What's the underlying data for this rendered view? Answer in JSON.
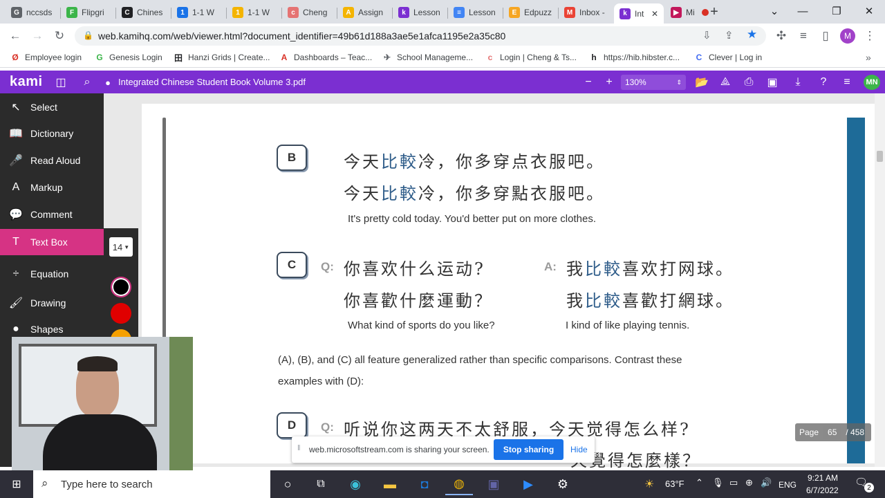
{
  "browser": {
    "tabs": [
      {
        "label": "nccsds",
        "fav": "G",
        "color": "#5f6368"
      },
      {
        "label": "Flipgri",
        "fav": "F",
        "color": "#3cb54a"
      },
      {
        "label": "Chines",
        "fav": "C",
        "color": "#202124"
      },
      {
        "label": "1-1 W",
        "fav": "1",
        "color": "#1a73e8"
      },
      {
        "label": "1-1 W",
        "fav": "1",
        "color": "#f4b400"
      },
      {
        "label": "Cheng",
        "fav": "c",
        "color": "#e57373"
      },
      {
        "label": "Assign",
        "fav": "A",
        "color": "#f4b400"
      },
      {
        "label": "Lesson",
        "fav": "k",
        "color": "#7b2fd1"
      },
      {
        "label": "Lesson",
        "fav": "≡",
        "color": "#4285f4"
      },
      {
        "label": "Edpuzz",
        "fav": "E",
        "color": "#f6a623"
      },
      {
        "label": "Inbox -",
        "fav": "M",
        "color": "#ea4335"
      },
      {
        "label": "Int",
        "fav": "k",
        "color": "#7b2fd1"
      },
      {
        "label": "Mi",
        "fav": "▶",
        "color": "#c2185b"
      }
    ],
    "new_tab": "+",
    "url": "web.kamihq.com/web/viewer.html?document_identifier=49b61d188a3ae5e1afca1195e2a35c80",
    "profile_initial": "M",
    "bookmarks": [
      {
        "label": "Employee login",
        "icon": "Ø",
        "color": "#d93025"
      },
      {
        "label": "Genesis Login",
        "icon": "G",
        "color": "#3cb54a"
      },
      {
        "label": "Hanzi Grids | Create...",
        "icon": "田",
        "color": "#202124"
      },
      {
        "label": "Dashboards – Teac...",
        "icon": "A",
        "color": "#d93025"
      },
      {
        "label": "School Manageme...",
        "icon": "✈",
        "color": "#5f6368"
      },
      {
        "label": "Login | Cheng & Ts...",
        "icon": "c",
        "color": "#e57373"
      },
      {
        "label": "https://hib.hibster.c...",
        "icon": "h",
        "color": "#202124"
      },
      {
        "label": "Clever | Log in",
        "icon": "C",
        "color": "#436cf2"
      }
    ],
    "bookmarks_more": "»"
  },
  "kami": {
    "logo": "kami",
    "document_title": "Integrated Chinese Student Book Volume 3.pdf",
    "zoom": "130%",
    "user_initials": "MN",
    "page_label": "Page",
    "page_current": "65",
    "page_total": "/ 458",
    "font_size": "14",
    "tools": [
      {
        "label": "Select",
        "icon": "↖"
      },
      {
        "label": "Dictionary",
        "icon": "📖"
      },
      {
        "label": "Read Aloud",
        "icon": "🎤"
      },
      {
        "label": "Markup",
        "icon": "A"
      },
      {
        "label": "Comment",
        "icon": "💬"
      },
      {
        "label": "Text Box",
        "icon": "T"
      },
      {
        "label": "Equation",
        "icon": "÷"
      },
      {
        "label": "Drawing",
        "icon": "🖌"
      },
      {
        "label": "Shapes",
        "icon": "●"
      }
    ],
    "colors": [
      "#000000",
      "#e00000",
      "#f5a000"
    ]
  },
  "document": {
    "B": {
      "label": "B",
      "simp_pre": "今天",
      "simp_hl": "比較",
      "simp_post": "冷，你多穿点衣服吧。",
      "trad_pre": "今天",
      "trad_hl": "比較",
      "trad_post": "冷，你多穿點衣服吧。",
      "english": "It's pretty cold today. You'd better put on more clothes."
    },
    "C": {
      "label": "C",
      "q": "Q:",
      "a": "A:",
      "q_simp": "你喜欢什么运动?",
      "q_trad": "你喜歡什麼運動？",
      "a_simp_pre": "我",
      "a_simp_hl": "比較",
      "a_simp_post": "喜欢打网球。",
      "a_trad_pre": "我",
      "a_trad_hl": "比較",
      "a_trad_post": "喜歡打網球。",
      "q_english": "What kind of sports do you like?",
      "a_english": "I kind of like playing tennis."
    },
    "note_line1": "(A), (B), and (C) all feature generalized rather than specific comparisons. Contrast these",
    "note_line2": "examples with (D):",
    "D": {
      "label": "D",
      "q": "Q:",
      "q_simp": "听说你这两天不太舒服，今天觉得怎么样?",
      "q_trad_partial": "天覺得怎麼樣？"
    }
  },
  "share_bar": {
    "text": "web.microsoftstream.com is sharing your screen.",
    "stop": "Stop sharing",
    "hide": "Hide"
  },
  "taskbar": {
    "search_placeholder": "Type here to search",
    "weather": "63°F",
    "language": "ENG",
    "time": "9:21 AM",
    "date": "6/7/2022",
    "notifications": "2"
  }
}
